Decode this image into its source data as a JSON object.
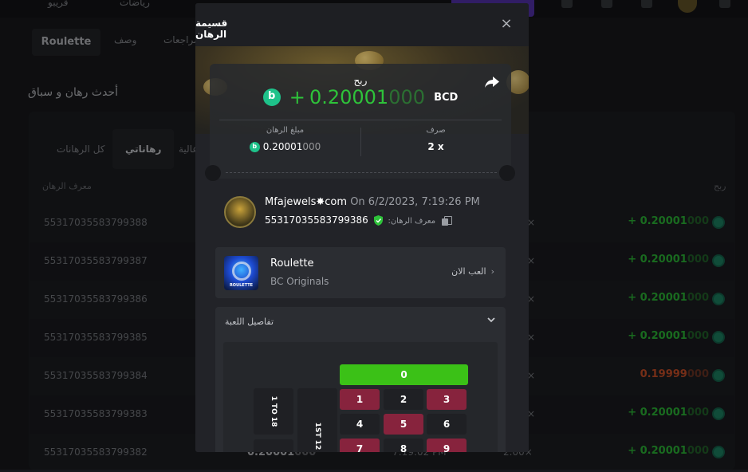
{
  "background": {
    "topbar": {
      "left_text_1": "قريبو",
      "left_text_2": "رياضات"
    },
    "tabs": {
      "active": "Roulette",
      "t2": "وصف",
      "t3": "مراجعات"
    },
    "heading": "أحدث رهان و سباق",
    "filters": {
      "all": "كل الرهانات",
      "mine": "رهاناتي",
      "high": "عالية"
    },
    "columns": {
      "bet_id": "معرف الرهان",
      "profit": "ربح"
    },
    "rows": [
      {
        "id": "55317035583799388",
        "profit_main": "+ 0.20001",
        "profit_dim": "000",
        "negative": false
      },
      {
        "id": "55317035583799387",
        "profit_main": "+ 0.20001",
        "profit_dim": "000",
        "negative": false
      },
      {
        "id": "55317035583799386",
        "profit_main": "+ 0.20001",
        "profit_dim": "000",
        "negative": false
      },
      {
        "id": "55317035583799385",
        "profit_main": "+ 0.20001",
        "profit_dim": "000",
        "negative": false
      },
      {
        "id": "55317035583799384",
        "profit_main": "0.19999",
        "profit_dim": "000",
        "negative": true
      },
      {
        "id": "55317035583799383",
        "profit_main": "+ 0.20001",
        "profit_dim": "000",
        "negative": false
      },
      {
        "id": "55317035583799382",
        "profit_main": "+ 0.20001",
        "profit_dim": "000",
        "negative": false
      }
    ],
    "last_row_amount": "0.20001",
    "last_row_amount_dim": "000",
    "last_row_time": "7:19:02 PM",
    "last_row_mult": "2.00×",
    "mult_glyph": "×"
  },
  "modal": {
    "title": "قسيمة الرهان",
    "close_label": "×",
    "win_label": "ربح",
    "win_sign": "+",
    "win_amount": "0.20001",
    "win_amount_dim": "000",
    "currency": "BCD",
    "bet_amount_label": "مبلغ الرهان",
    "bet_amount": "0.20001",
    "bet_amount_dim": "000",
    "payout_label": "صرف",
    "payout_value": "2 x",
    "user": {
      "name": "Mfajewels✸com",
      "on_text": "On 6/2/2023, 7:19:26 PM",
      "bet_id_label": "معرف الرهان:",
      "bet_id": "55317035583799386"
    },
    "game": {
      "name": "Roulette",
      "provider": "BC Originals",
      "play_now": "العب الان",
      "thumb_label": "ROULETTE"
    },
    "details": {
      "title": "تفاصيل اللعبة",
      "zero": "0",
      "numbers": [
        "1",
        "2",
        "3",
        "4",
        "5",
        "6",
        "7",
        "8",
        "9"
      ],
      "range_label": "1 TO 18",
      "dozen_label": "1ST 12"
    }
  },
  "colors": {
    "win_green": "#2ec33a",
    "loss_orange": "#d8552b",
    "roulette_red": "#87233d",
    "zero_green": "#3bc117",
    "coin_teal": "#1ec28a"
  }
}
